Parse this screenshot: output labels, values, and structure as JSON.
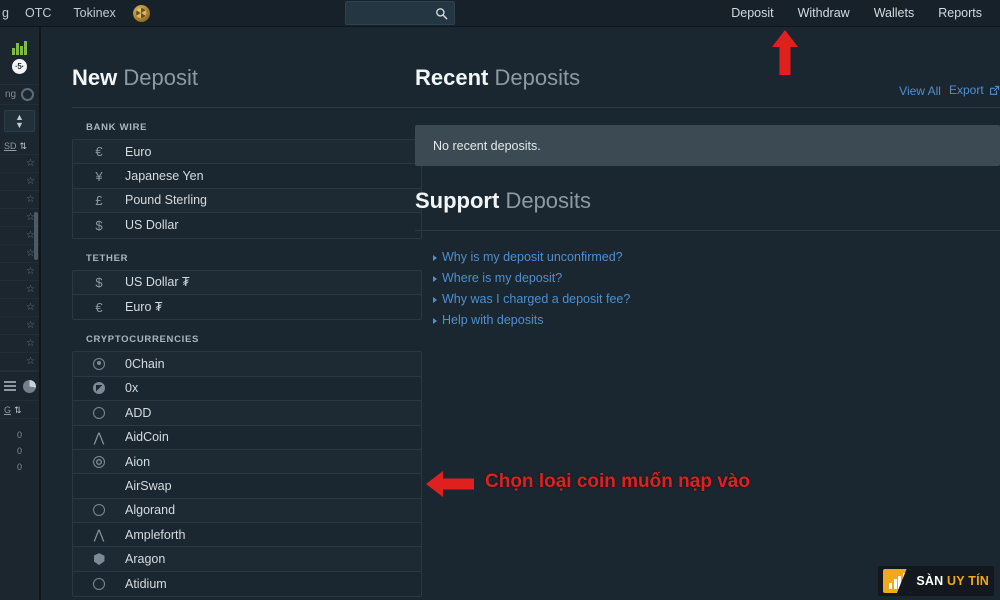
{
  "topbar": {
    "left_items": [
      {
        "label": "g",
        "name": "nav-item-clipped"
      },
      {
        "label": "OTC",
        "name": "nav-item-otc"
      },
      {
        "label": "Tokinex",
        "name": "nav-item-tokinex"
      }
    ],
    "logo_name": "tokinex-logo-icon",
    "search": {
      "value": "",
      "placeholder": ""
    },
    "right_items": [
      {
        "label": "Deposit",
        "name": "nav-item-deposit"
      },
      {
        "label": "Withdraw",
        "name": "nav-item-withdraw"
      },
      {
        "label": "Wallets",
        "name": "nav-item-wallets"
      },
      {
        "label": "Reports",
        "name": "nav-item-reports"
      }
    ]
  },
  "left_rail": {
    "badge": "·5·",
    "settings_row_label": "ng",
    "pair_label": "SD",
    "pairs": [
      "",
      "",
      "",
      "",
      "",
      "",
      "",
      "",
      "",
      "",
      "",
      ""
    ],
    "ticker_label": "G",
    "numbers": [
      "0",
      "0",
      "0"
    ]
  },
  "new_deposit": {
    "title_strong": "New",
    "title_light": "Deposit",
    "groups": [
      {
        "label": "BANK WIRE",
        "name": "group-bank-wire",
        "items": [
          {
            "icon": "euro-icon",
            "glyph": "€",
            "label": "Euro"
          },
          {
            "icon": "yen-icon",
            "glyph": "¥",
            "label": "Japanese Yen"
          },
          {
            "icon": "pound-icon",
            "glyph": "£",
            "label": "Pound Sterling"
          },
          {
            "icon": "dollar-icon",
            "glyph": "$",
            "label": "US Dollar"
          }
        ]
      },
      {
        "label": "TETHER",
        "name": "group-tether",
        "items": [
          {
            "icon": "dollar-icon",
            "glyph": "$",
            "label": "US Dollar ₮"
          },
          {
            "icon": "euro-icon",
            "glyph": "€",
            "label": "Euro ₮"
          }
        ]
      },
      {
        "label": "CRYPTOCURRENCIES",
        "name": "group-cryptocurrencies",
        "items": [
          {
            "icon": "zerochain-icon",
            "shape": "dot",
            "label": "0Chain"
          },
          {
            "icon": "zerox-icon",
            "shape": "x",
            "label": "0x"
          },
          {
            "icon": "add-icon",
            "shape": "circle",
            "label": "ADD"
          },
          {
            "icon": "aidcoin-icon",
            "shape": "caret",
            "glyph": "⋀",
            "label": "AidCoin"
          },
          {
            "icon": "aion-icon",
            "shape": "ring",
            "label": "Aion"
          },
          {
            "icon": "airswap-icon",
            "shape": "blank",
            "label": "AirSwap"
          },
          {
            "icon": "algorand-icon",
            "shape": "circle",
            "label": "Algorand"
          },
          {
            "icon": "ampleforth-icon",
            "shape": "caret",
            "glyph": "⋀",
            "label": "Ampleforth"
          },
          {
            "icon": "aragon-icon",
            "shape": "shield",
            "label": "Aragon"
          },
          {
            "icon": "atidium-icon",
            "shape": "circle",
            "label": "Atidium"
          }
        ]
      }
    ]
  },
  "recent_deposits": {
    "title_strong": "Recent",
    "title_light": "Deposits",
    "view_all_label": "View All",
    "export_label": "Export",
    "empty_message": "No recent deposits."
  },
  "support": {
    "title_strong": "Support",
    "title_light": "Deposits",
    "links": [
      "Why is my deposit unconfirmed?",
      "Where is my deposit?",
      "Why was I charged a deposit fee?",
      "Help with deposits"
    ]
  },
  "annotations": {
    "callout_text": "Chọn loại coin muốn nạp vào",
    "arrow_color": "#e01f1f"
  },
  "watermark": {
    "text_white": "SÀN ",
    "text_orange": "UY TÍN",
    "brand_color": "#f0a81d"
  }
}
